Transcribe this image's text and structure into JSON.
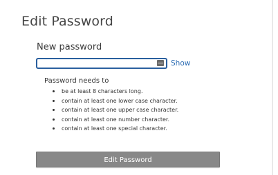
{
  "page": {
    "title": "Edit Password"
  },
  "password_field": {
    "label": "New password",
    "value": "",
    "placeholder": "",
    "show_label": "Show",
    "icon": "password-manager-key-icon",
    "focus_color": "#2a5f9e"
  },
  "requirements": {
    "title": "Password needs to",
    "items": [
      "be at least 8 characters long.",
      "contain at least one lower case character.",
      "contain at least one upper case character.",
      "contain at least one number character.",
      "contain at least one special character."
    ]
  },
  "submit": {
    "label": "Edit Password",
    "color": "#888888"
  }
}
